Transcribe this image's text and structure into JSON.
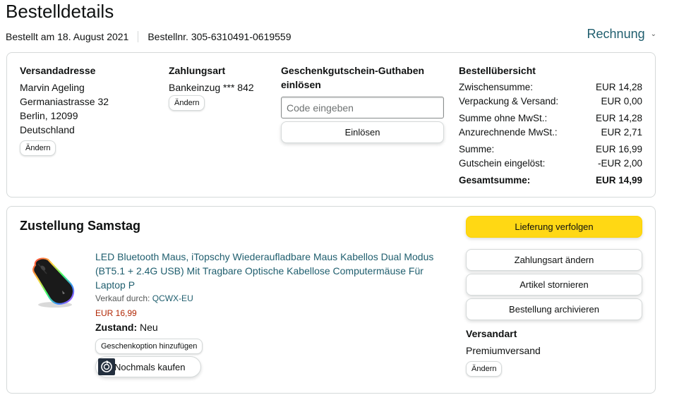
{
  "header": {
    "title": "Bestelldetails",
    "order_date": "Bestellt am 18. August 2021",
    "order_number": "Bestellnr. 305-6310491-0619559",
    "invoice_label": "Rechnung"
  },
  "shipping_address": {
    "heading": "Versandadresse",
    "name": "Marvin Ageling",
    "street": "Germaniastrasse 32",
    "city": "Berlin, 12099",
    "country": "Deutschland",
    "change_label": "Ändern"
  },
  "payment": {
    "heading": "Zahlungsart",
    "method": "Bankeinzug *** 842",
    "change_label": "Ändern"
  },
  "gift_card": {
    "heading_line1": "Geschenkgutschein-Guthaben",
    "heading_line2": "einlösen",
    "placeholder": "Code eingeben",
    "redeem_label": "Einlösen"
  },
  "summary": {
    "heading": "Bestellübersicht",
    "rows": [
      {
        "label": "Zwischensumme:",
        "value": "EUR 14,28"
      },
      {
        "label": "Verpackung & Versand:",
        "value": "EUR 0,00"
      },
      {
        "label": "Summe ohne MwSt.:",
        "value": "EUR 14,28"
      },
      {
        "label": "Anzurechnende MwSt.:",
        "value": "EUR 2,71"
      },
      {
        "label": "Summe:",
        "value": "EUR 16,99"
      },
      {
        "label": "Gutschein eingelöst:",
        "value": "-EUR 2,00"
      },
      {
        "label": "Gesamtsumme:",
        "value": "EUR 14,99"
      }
    ]
  },
  "delivery": {
    "heading": "Zustellung Samstag",
    "product": {
      "title": "LED Bluetooth Maus, iTopschy Wiederaufladbare Maus Kabellos Dual Modus (BT5.1 + 2.4G USB) Mit Tragbare Optische Kabellose Computermäuse Für Laptop P",
      "seller_prefix": "Verkauf durch:",
      "seller_name": "QCWX-EU",
      "price": "EUR 16,99",
      "condition_label": "Zustand:",
      "condition_value": "Neu",
      "gift_option_label": "Geschenkoption hinzufügen",
      "buy_again_label": "Nochmals kaufen"
    },
    "actions": {
      "track": "Lieferung verfolgen",
      "change_payment": "Zahlungsart ändern",
      "cancel": "Artikel stornieren",
      "archive": "Bestellung archivieren"
    },
    "shipping_method": {
      "heading": "Versandart",
      "value": "Premiumversand",
      "change_label": "Ändern"
    }
  },
  "colors": {
    "link": "#1f5e6e",
    "price": "#b12704",
    "primary_button": "#ffd814",
    "border": "#d5d9d9"
  }
}
